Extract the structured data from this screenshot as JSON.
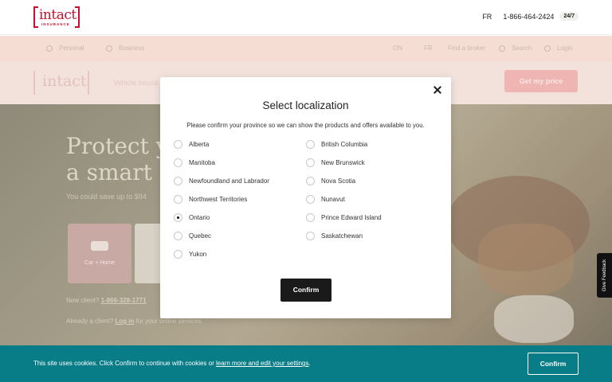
{
  "header": {
    "logo_word": "intact",
    "logo_sub": "INSURANCE",
    "lang": "FR",
    "phone": "1-866-464-2424",
    "badge": "24/7"
  },
  "nav": {
    "personal": "Personal",
    "business": "Business",
    "on": "ON",
    "fr": "FR",
    "find_broker": "Find a broker",
    "search": "Search",
    "login": "Login"
  },
  "subnav": {
    "logo_word": "intact",
    "vehicle": "Vehicle insura",
    "get_price": "Get my price"
  },
  "hero": {
    "headline_1": "Protect y",
    "headline_2": "a smart",
    "save_text": "You could save up to $94",
    "card1_label": "Car + Home",
    "new_client": "New client?",
    "new_client_phone": "1-866-328-1771",
    "already_client": "Already a client?",
    "log_in": "Log in",
    "already_rest": "for your online services"
  },
  "modal": {
    "title": "Select localization",
    "description": "Please confirm your province so we can show the products and offers available to you.",
    "provinces_left": [
      "Alberta",
      "Manitoba",
      "Newfoundland and Labrador",
      "Northwest Territories",
      "Ontario",
      "Quebec",
      "Yukon"
    ],
    "provinces_right": [
      "British Columbia",
      "New Brunswick",
      "Nova Scotia",
      "Nunavut",
      "Prince Edward Island",
      "Saskatchewan"
    ],
    "selected": "Ontario",
    "confirm_label": "Confirm"
  },
  "cookie": {
    "text_before": "This site uses cookies. Click Confirm to continue with cookies or ",
    "link_text": "learn more and edit your settings",
    "text_after": ".",
    "button_label": "Confirm"
  },
  "feedback": {
    "label": "Give Feedback"
  },
  "colors": {
    "brand": "#c8102e",
    "cookie_bar": "#087c87",
    "modal_button": "#1a1a1a"
  }
}
